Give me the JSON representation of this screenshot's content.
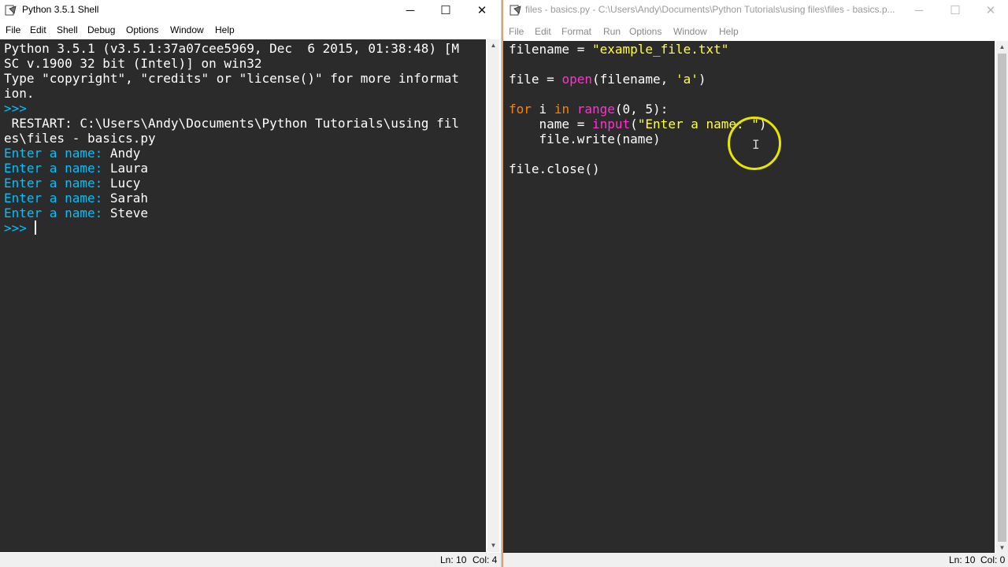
{
  "shell": {
    "title": "Python 3.5.1 Shell",
    "menu": [
      "File",
      "Edit",
      "Shell",
      "Debug",
      "Options",
      "Window",
      "Help"
    ],
    "lines": [
      "Python 3.5.1 (v3.5.1:37a07cee5969, Dec  6 2015, 01:38:48) [M",
      "SC v.1900 32 bit (Intel)] on win32",
      "Type \"copyright\", \"credits\" or \"license()\" for more informat",
      "ion.",
      ">>> ",
      " RESTART: C:\\Users\\Andy\\Documents\\Python Tutorials\\using fil",
      "es\\files - basics.py"
    ],
    "inputs": [
      {
        "prompt": "Enter a name: ",
        "value": "Andy"
      },
      {
        "prompt": "Enter a name: ",
        "value": "Laura"
      },
      {
        "prompt": "Enter a name: ",
        "value": "Lucy"
      },
      {
        "prompt": "Enter a name: ",
        "value": "Sarah"
      },
      {
        "prompt": "Enter a name: ",
        "value": "Steve"
      }
    ],
    "final_prompt": ">>> ",
    "status": {
      "ln": "Ln: 10",
      "col": "Col: 4"
    }
  },
  "editor": {
    "title": "files - basics.py - C:\\Users\\Andy\\Documents\\Python Tutorials\\using files\\files - basics.p...",
    "menu": [
      "File",
      "Edit",
      "Format",
      "Run",
      "Options",
      "Window",
      "Help"
    ],
    "code": {
      "l1": {
        "a": "filename = ",
        "b": "\"example_file.txt\""
      },
      "l3": {
        "a": "file = ",
        "b": "open",
        "c": "(filename, ",
        "d": "'a'",
        "e": ")"
      },
      "l5": {
        "a": "for",
        "b": " i ",
        "c": "in",
        "d": " ",
        "e": "range",
        "f": "(0, 5):"
      },
      "l6": {
        "a": "    name = ",
        "b": "input",
        "c": "(",
        "d": "\"Enter a name: \"",
        "e": ")"
      },
      "l7": {
        "a": "    file.write(name)"
      },
      "l9": {
        "a": "file.close()"
      }
    },
    "status": {
      "ln": "Ln: 10",
      "col": "Col: 0"
    }
  },
  "window_controls": {
    "minimize": "─",
    "maximize": "☐",
    "close": "✕"
  },
  "cursor": {
    "ibeam": "I"
  }
}
